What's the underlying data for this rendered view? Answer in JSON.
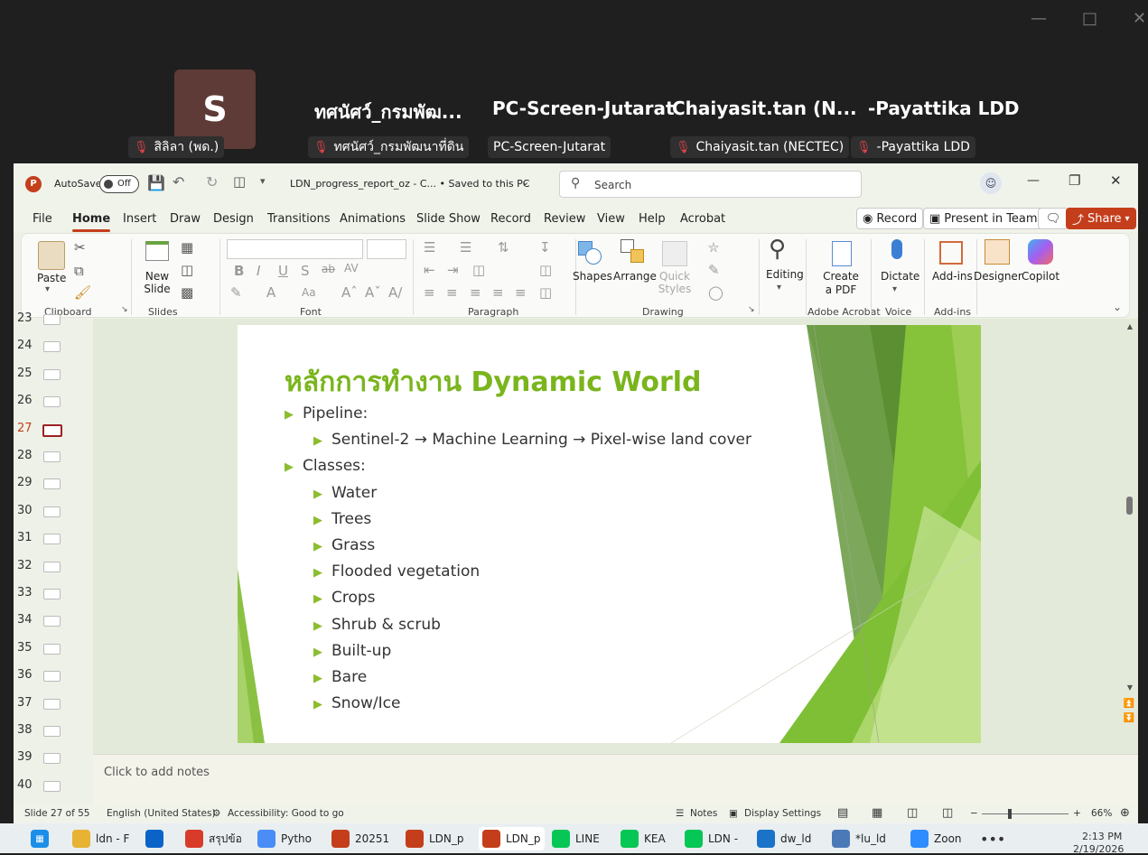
{
  "meeting": {
    "avatar_initial": "S",
    "tiles": [
      "ทศนัศว์_กรมพัฒ...",
      "PC-Screen-Jutarat",
      "Chaiyasit.tan  (N...",
      "-Payattika LDD"
    ],
    "chips": [
      "สิลิลา (พด.)",
      "ทศนัศว์_กรมพัฒนาที่ดิน",
      "PC-Screen-Jutarat",
      "Chaiyasit.tan (NECTEC)",
      "-Payattika LDD"
    ]
  },
  "titlebar": {
    "autosave_label": "AutoSave",
    "autosave_state": "Off",
    "doc_title": "LDN_progress_report_oz - C...  •  Saved to this PC",
    "search_placeholder": "Search"
  },
  "menu": [
    "File",
    "Home",
    "Insert",
    "Draw",
    "Design",
    "Transitions",
    "Animations",
    "Slide Show",
    "Record",
    "Review",
    "View",
    "Help",
    "Acrobat"
  ],
  "menu_buttons": {
    "record": "Record",
    "present": "Present in Teams",
    "share": "Share"
  },
  "ribbon": {
    "paste": "Paste",
    "new_slide": "New Slide",
    "groups": {
      "clipboard": "Clipboard",
      "slides": "Slides",
      "font": "Font",
      "paragraph": "Paragraph",
      "drawing": "Drawing",
      "acrobat": "Adobe Acrobat",
      "voice": "Voice",
      "addins": "Add-ins"
    },
    "shapes": "Shapes",
    "arrange": "Arrange",
    "quick_styles": "Quick Styles",
    "editing": "Editing",
    "create_pdf": "Create a PDF",
    "dictate": "Dictate",
    "addins_btn": "Add-ins",
    "designer": "Designer",
    "copilot": "Copilot"
  },
  "thumbnails": [
    {
      "n": "23"
    },
    {
      "n": "24"
    },
    {
      "n": "25"
    },
    {
      "n": "26"
    },
    {
      "n": "27"
    },
    {
      "n": "28"
    },
    {
      "n": "29"
    },
    {
      "n": "30"
    },
    {
      "n": "31"
    },
    {
      "n": "32"
    },
    {
      "n": "33"
    },
    {
      "n": "34"
    },
    {
      "n": "35"
    },
    {
      "n": "36"
    },
    {
      "n": "37"
    },
    {
      "n": "38"
    },
    {
      "n": "39"
    },
    {
      "n": "40"
    }
  ],
  "current_slide_number": "27",
  "slide": {
    "title": "หลักการทำงาน Dynamic World",
    "bullets": [
      {
        "level": 1,
        "text": "Pipeline:"
      },
      {
        "level": 2,
        "text": "Sentinel-2 → Machine Learning → Pixel-wise land cover"
      },
      {
        "level": 1,
        "text": "Classes:"
      },
      {
        "level": 2,
        "text": "Water"
      },
      {
        "level": 2,
        "text": "Trees"
      },
      {
        "level": 2,
        "text": "Grass"
      },
      {
        "level": 2,
        "text": "Flooded vegetation"
      },
      {
        "level": 2,
        "text": "Crops"
      },
      {
        "level": 2,
        "text": "Shrub & scrub"
      },
      {
        "level": 2,
        "text": "Built-up"
      },
      {
        "level": 2,
        "text": "Bare"
      },
      {
        "level": 2,
        "text": "Snow/Ice"
      }
    ]
  },
  "notes_placeholder": "Click to add notes",
  "status": {
    "slide_of": "Slide 27 of 55",
    "language": "English (United States)",
    "accessibility": "Accessibility: Good to go",
    "notes": "Notes",
    "display": "Display Settings",
    "zoom": "66%"
  },
  "taskbar": {
    "items": [
      {
        "label": "ldn - F",
        "color": "#e8b233"
      },
      {
        "label": "",
        "color": "#0a64c8"
      },
      {
        "label": "สรุปข้อ",
        "color": "#d93b2b"
      },
      {
        "label": "Pytho",
        "color": "#4a8df6"
      },
      {
        "label": "20251",
        "color": "#c43e1c"
      },
      {
        "label": "LDN_p",
        "color": "#c43e1c"
      },
      {
        "label": "LDN_p",
        "color": "#c43e1c"
      },
      {
        "label": "LINE",
        "color": "#06c755"
      },
      {
        "label": "KEA",
        "color": "#06c755"
      },
      {
        "label": "LDN -",
        "color": "#06c755"
      },
      {
        "label": "dw_ld",
        "color": "#1a73c8"
      },
      {
        "label": "*lu_ld",
        "color": "#4b79b8"
      },
      {
        "label": "Zoon",
        "color": "#2d8cff"
      }
    ],
    "time": "2:13 PM",
    "date": "2/19/2026"
  },
  "colors": {
    "accent": "#c43e1c",
    "slide_title": "#7ab51d",
    "bullet": "#8bbd2f"
  }
}
